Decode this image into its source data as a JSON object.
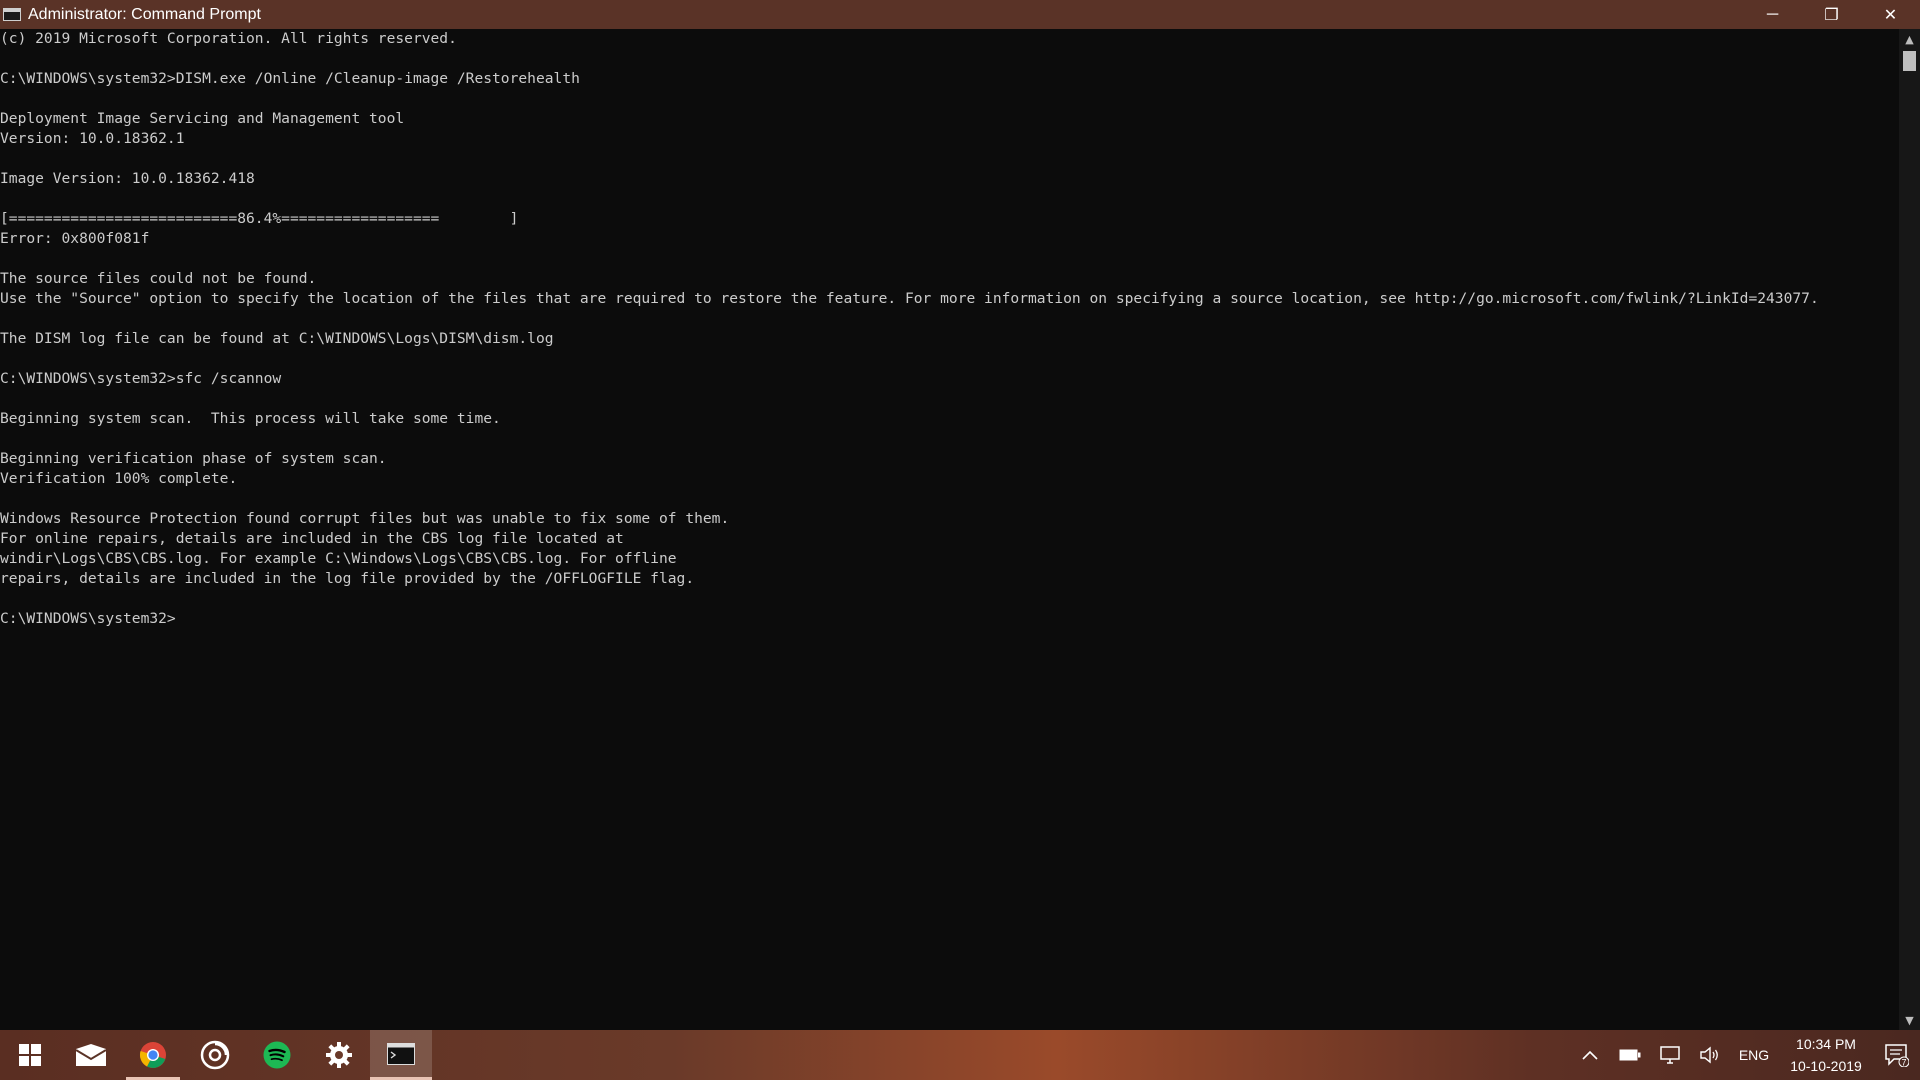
{
  "window": {
    "title": "Administrator: Command Prompt",
    "minimize": "─",
    "restore": "❐",
    "close": "✕"
  },
  "console": {
    "lines": [
      "(c) 2019 Microsoft Corporation. All rights reserved.",
      "",
      "C:\\WINDOWS\\system32>DISM.exe /Online /Cleanup-image /Restorehealth",
      "",
      "Deployment Image Servicing and Management tool",
      "Version: 10.0.18362.1",
      "",
      "Image Version: 10.0.18362.418",
      "",
      "[==========================86.4%==================        ]",
      "Error: 0x800f081f",
      "",
      "The source files could not be found.",
      "Use the \"Source\" option to specify the location of the files that are required to restore the feature. For more information on specifying a source location, see http://go.microsoft.com/fwlink/?LinkId=243077.",
      "",
      "The DISM log file can be found at C:\\WINDOWS\\Logs\\DISM\\dism.log",
      "",
      "C:\\WINDOWS\\system32>sfc /scannow",
      "",
      "Beginning system scan.  This process will take some time.",
      "",
      "Beginning verification phase of system scan.",
      "Verification 100% complete.",
      "",
      "Windows Resource Protection found corrupt files but was unable to fix some of them.",
      "For online repairs, details are included in the CBS log file located at",
      "windir\\Logs\\CBS\\CBS.log. For example C:\\Windows\\Logs\\CBS\\CBS.log. For offline",
      "repairs, details are included in the log file provided by the /OFFLOGFILE flag.",
      "",
      "C:\\WINDOWS\\system32>"
    ],
    "progress": 0.864
  },
  "taskbar": {
    "apps": [
      {
        "name": "start-button",
        "icon": "windows-logo-icon"
      },
      {
        "name": "mail-app",
        "icon": "mail-icon"
      },
      {
        "name": "chrome-app",
        "icon": "chrome-icon",
        "running": true
      },
      {
        "name": "groove-app",
        "icon": "groove-music-icon"
      },
      {
        "name": "spotify-app",
        "icon": "spotify-icon"
      },
      {
        "name": "settings-app",
        "icon": "gear-icon"
      },
      {
        "name": "cmd-app",
        "icon": "command-prompt-icon",
        "active": true
      }
    ]
  },
  "tray": {
    "language": "ENG",
    "time": "10:34 PM",
    "date": "10-10-2019",
    "notification_count": "7"
  },
  "colors": {
    "console_bg": "#0c0c0c",
    "console_text": "#cccccc",
    "titlebar": "#5a3327",
    "spotify": "#1db954"
  }
}
